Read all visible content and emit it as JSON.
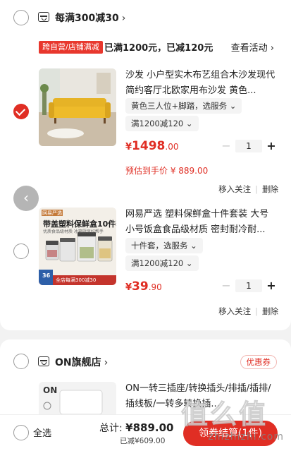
{
  "stores": [
    {
      "name": "每满300减30",
      "chevron": "›"
    },
    {
      "name": "ON旗舰店",
      "chevron": "›",
      "coupon_label": "优惠券"
    }
  ],
  "promo": {
    "tag": "跨自营/店铺满减",
    "text": "已满1200元，已减120元",
    "link": "查看活动 ›"
  },
  "products": [
    {
      "title": "沙发 小户型实木布艺组合木沙发现代简约客厅北欧家用布沙发 黄色...",
      "spec": "黄色三人位+脚踏，选服务 ⌄",
      "promo": "满1200减120 ⌄",
      "price_currency": "¥",
      "price_int": "1498",
      "price_dec": ".00",
      "quantity": "1",
      "minus": "−",
      "plus": "+",
      "est_label": "预估到手价 ¥ 889.00",
      "action_follow": "移入关注",
      "action_delete": "删除",
      "checked": true
    },
    {
      "title": "网易严选 塑料保鲜盒十件套装 大号小号饭盒食品级材质 密封耐冷耐...",
      "spec": "十件套，选服务 ⌄",
      "promo": "满1200减120 ⌄",
      "price_currency": "¥",
      "price_int": "39",
      "price_dec": ".90",
      "quantity": "1",
      "minus": "−",
      "plus": "+",
      "action_follow": "移入关注",
      "action_delete": "删除",
      "checked": false,
      "thumb_brand": "网易严选",
      "thumb_headline": "带盖塑料保鲜盒10件套",
      "thumb_sub": "优质食品级材质 冰箱厨房好帮手",
      "thumb_badge": "36",
      "thumb_banner": "全店每满300减30"
    },
    {
      "title": "ON一转三插座/转换插头/排插/插排/插线板/一转多转换插...",
      "thumb_brand": "ON"
    }
  ],
  "back_arrow": "‹",
  "bottom_bar": {
    "select_all": "全选",
    "total_label": "总计:",
    "total_value": "¥889.00",
    "reduced": "已减¥609.00",
    "checkout": "领券结算(1件)"
  },
  "watermark": {
    "text": "值么值",
    "url": "zhizhizhi.com"
  },
  "colors": {
    "accent": "#e02e24",
    "background": "#f2f2f2"
  }
}
